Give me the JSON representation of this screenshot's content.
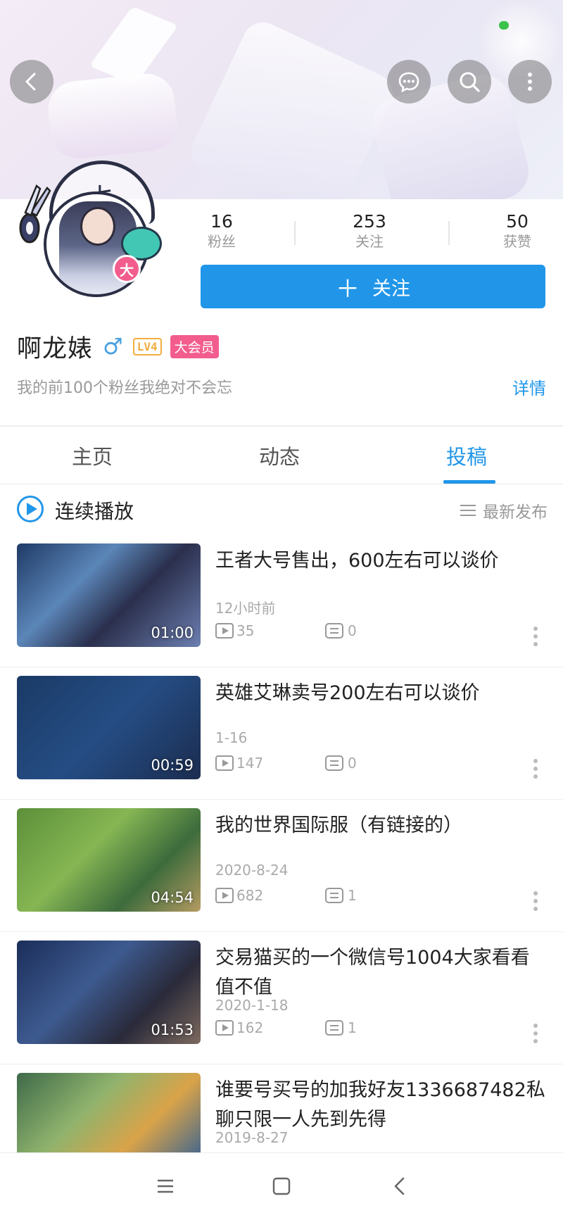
{
  "header": {
    "back_icon": "arrow-left-icon",
    "message_icon": "chat-bubble-icon",
    "search_icon": "search-icon",
    "more_icon": "more-vertical-icon"
  },
  "profile": {
    "avatar_text": "七",
    "avatar_badge": "大",
    "stats": [
      {
        "value": "16",
        "label": "粉丝"
      },
      {
        "value": "253",
        "label": "关注"
      },
      {
        "value": "50",
        "label": "获赞"
      }
    ],
    "follow_label": "关注",
    "follow_icon": "＋",
    "name": "啊龙婊",
    "gender_symbol": "♂",
    "level": "LV4",
    "vip_label": "大会员",
    "signature": "我的前100个粉丝我绝对不会忘",
    "detail_link": "详情"
  },
  "tabs": [
    {
      "label": "主页",
      "active": false
    },
    {
      "label": "动态",
      "active": false
    },
    {
      "label": "投稿",
      "active": true
    }
  ],
  "toolbar": {
    "continuous_play": "连续播放",
    "sort_label": "最新发布"
  },
  "videos": [
    {
      "title": "王者大号售出，600左右可以谈价",
      "date": "12小时前",
      "plays": "35",
      "comments": "0",
      "duration": "01:00"
    },
    {
      "title": "英雄艾琳卖号200左右可以谈价",
      "date": "1-16",
      "plays": "147",
      "comments": "0",
      "duration": "00:59"
    },
    {
      "title": "我的世界国际服（有链接的）",
      "date": "2020-8-24",
      "plays": "682",
      "comments": "1",
      "duration": "04:54"
    },
    {
      "title": "交易猫买的一个微信号1004大家看看值不值",
      "date": "2020-1-18",
      "plays": "162",
      "comments": "1",
      "duration": "01:53"
    },
    {
      "title": "谁要号买号的加我好友1336687482私聊只限一人先到先得",
      "date": "2019-8-27",
      "plays": "",
      "comments": "",
      "duration": ""
    }
  ],
  "colors": {
    "accent": "#2196e9",
    "vip": "#f25d8e",
    "level": "#f2ad3e"
  }
}
